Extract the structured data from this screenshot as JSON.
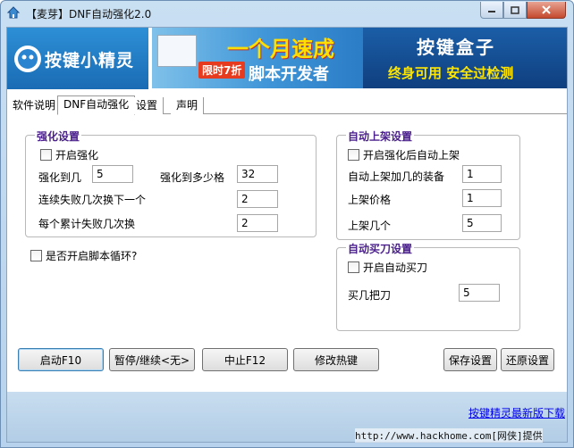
{
  "window": {
    "title": "【麦芽】DNF自动强化2.0"
  },
  "banner": {
    "logo_text": "按键小精灵",
    "ad1_headline": "一个月速成",
    "ad1_subline": "脚本开发者",
    "ad1_tag": "限时7折",
    "ad2_title": "按键盒子",
    "ad2_subline": "终身可用  安全过检测"
  },
  "tabs": [
    {
      "label": "软件说明",
      "active": false
    },
    {
      "label": "DNF自动强化",
      "active": true
    },
    {
      "label": "设置",
      "active": false
    },
    {
      "label": "声明",
      "active": false
    }
  ],
  "strengthen": {
    "title": "强化设置",
    "enable_label": "开启强化",
    "enable_checked": false,
    "level_label": "强化到几",
    "level_value": "5",
    "cells_label": "强化到多少格",
    "cells_value": "32",
    "fail_switch_label": "连续失败几次换下一个",
    "fail_switch_value": "2",
    "cumulative_fail_label": "每个累计失败几次换",
    "cumulative_fail_value": "2"
  },
  "loop": {
    "label": "是否开启脚本循环?",
    "checked": false
  },
  "auto_list": {
    "title": "自动上架设置",
    "enable_label": "开启强化后自动上架",
    "enable_checked": false,
    "plus_label": "自动上架加几的装备",
    "plus_value": "1",
    "price_label": "上架价格",
    "price_value": "1",
    "count_label": "上架几个",
    "count_value": "5"
  },
  "auto_buy": {
    "title": "自动买刀设置",
    "enable_label": "开启自动买刀",
    "enable_checked": false,
    "count_label": "买几把刀",
    "count_value": "5"
  },
  "buttons": {
    "start": "启动F10",
    "pause": "暂停/继续<无>",
    "stop": "中止F12",
    "hotkey": "修改热键",
    "save": "保存设置",
    "restore": "还原设置"
  },
  "footer": {
    "download_link": "按键精灵最新版下载",
    "watermark": "http://www.hackhome.com[网侠]提供"
  },
  "colors": {
    "group_title": "#4a1f8c",
    "frame": "#b7d2ec",
    "link": "#0000ee"
  }
}
